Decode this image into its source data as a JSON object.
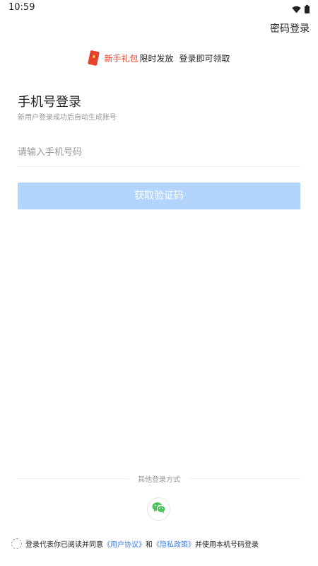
{
  "status_bar": {
    "time": "10:59",
    "icons": [
      "wifi-icon",
      "battery-icon"
    ]
  },
  "header": {
    "password_login": "密码登录"
  },
  "gift_banner": {
    "icon": "red-envelope-icon",
    "highlight": "新手礼包",
    "text1": "限时发放",
    "text2": "登录即可领取"
  },
  "login": {
    "title": "手机号登录",
    "subtitle": "新用户登录成功后自动生成账号",
    "phone_placeholder": "请输入手机号码",
    "phone_value": "",
    "get_code_label": "获取验证码"
  },
  "other_methods": {
    "label": "其他登录方式",
    "icons": [
      "wechat-icon"
    ]
  },
  "agreement": {
    "prefix": "登录代表你已阅读并同意",
    "user_agreement": "《用户协议》",
    "and": "和",
    "privacy_policy": "《隐私政策》",
    "suffix": "并使用本机号码登录"
  },
  "colors": {
    "accent_disabled": "#b3d4fc",
    "link": "#3f7fe8",
    "gift_red": "#e8432f",
    "wechat_green": "#4cc35a"
  }
}
